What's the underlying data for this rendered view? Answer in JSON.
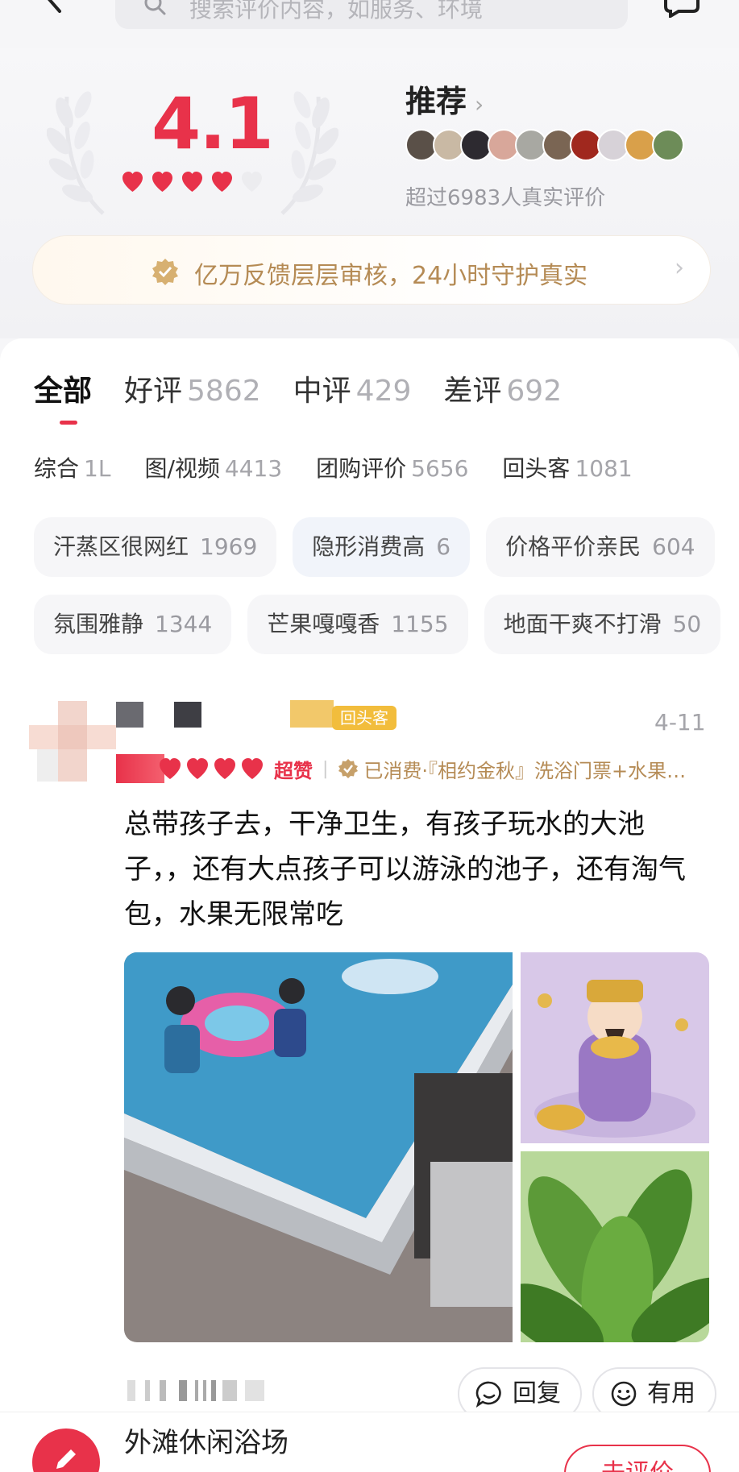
{
  "search": {
    "placeholder": "搜索评价内容，如服务、环境"
  },
  "summary": {
    "score": "4.1",
    "hearts_filled": 4,
    "hearts_total": 5,
    "recommend_label": "推荐",
    "real_review_count": "超过6983人真实评价",
    "notice": "亿万反馈层层审核，24小时守护真实"
  },
  "colors": {
    "accent": "#e8324a",
    "gold": "#b58b55",
    "muted": "#a5a5aa"
  },
  "tabs": [
    {
      "label": "全部",
      "count": ""
    },
    {
      "label": "好评",
      "count": "5862"
    },
    {
      "label": "中评",
      "count": "429"
    },
    {
      "label": "差评",
      "count": "692"
    }
  ],
  "subtabs": [
    {
      "label": "综合",
      "count": "1L"
    },
    {
      "label": "图/视频",
      "count": "4413"
    },
    {
      "label": "团购评价",
      "count": "5656"
    },
    {
      "label": "回头客",
      "count": "1081"
    }
  ],
  "chips_row1": [
    {
      "label": "汗蒸区很网红",
      "count": "1969"
    },
    {
      "label": "隐形消费高",
      "count": "6"
    },
    {
      "label": "价格平价亲民",
      "count": "604"
    }
  ],
  "chips_row2": [
    {
      "label": "氛围雅静",
      "count": "1344"
    },
    {
      "label": "芒果嘎嘎香",
      "count": "1155"
    },
    {
      "label": "地面干爽不打滑",
      "count": "50"
    }
  ],
  "review": {
    "badge": "回头客",
    "date": "4-11",
    "rating_text": "超赞",
    "consumed": "已消费·『相约金秋』洗浴门票+水果…",
    "text": "总带孩子去，干净卫生，有孩子玩水的大池子，，还有大点孩子可以游泳的池子，还有淘气包，水果无限常吃",
    "reply_label": "回复",
    "useful_label": "有用"
  },
  "bottom": {
    "shop_name": "外滩休闲浴场",
    "go_review": "去评价"
  }
}
